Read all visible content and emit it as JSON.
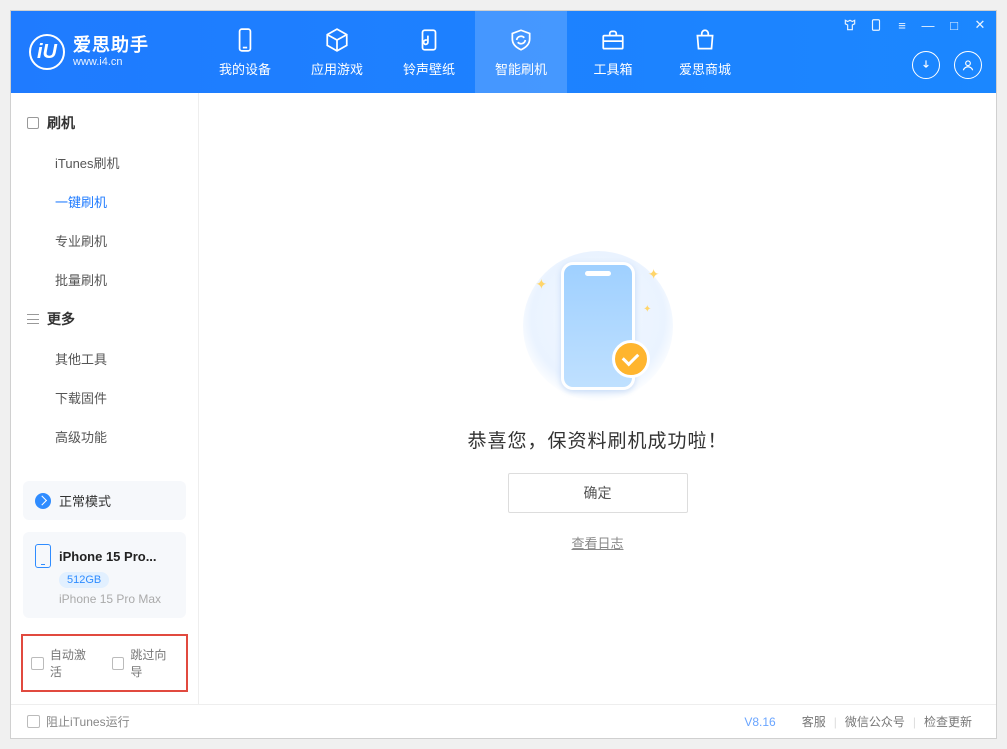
{
  "brand": {
    "name": "爱思助手",
    "url": "www.i4.cn"
  },
  "tabs": [
    {
      "id": "device",
      "label": "我的设备"
    },
    {
      "id": "apps",
      "label": "应用游戏"
    },
    {
      "id": "ring",
      "label": "铃声壁纸"
    },
    {
      "id": "flash",
      "label": "智能刷机"
    },
    {
      "id": "tools",
      "label": "工具箱"
    },
    {
      "id": "store",
      "label": "爱思商城"
    }
  ],
  "sidebar": {
    "section1": {
      "title": "刷机",
      "items": [
        {
          "label": "iTunes刷机"
        },
        {
          "label": "一键刷机"
        },
        {
          "label": "专业刷机"
        },
        {
          "label": "批量刷机"
        }
      ]
    },
    "section2": {
      "title": "更多",
      "items": [
        {
          "label": "其他工具"
        },
        {
          "label": "下载固件"
        },
        {
          "label": "高级功能"
        }
      ]
    }
  },
  "mode": {
    "label": "正常模式"
  },
  "device": {
    "name": "iPhone 15 Pro...",
    "storage": "512GB",
    "model": "iPhone 15 Pro Max"
  },
  "options": {
    "auto_activate": "自动激活",
    "skip_guide": "跳过向导"
  },
  "main": {
    "message": "恭喜您，保资料刷机成功啦！",
    "ok": "确定",
    "log": "查看日志"
  },
  "footer": {
    "block_itunes": "阻止iTunes运行",
    "version": "V8.16",
    "links": [
      "客服",
      "微信公众号",
      "检查更新"
    ]
  }
}
